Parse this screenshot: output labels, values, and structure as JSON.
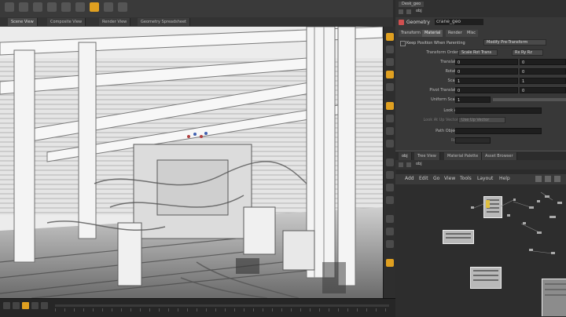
{
  "colors": {
    "accent": "#e0a020",
    "viewport_bg": "#e8e8e8",
    "panel_bg": "#383838",
    "node": "#b9b9b9"
  },
  "viewport_tabs": [
    "Scene View",
    "Composite View",
    "Render View",
    "Geometry Spreadsheet"
  ],
  "right_top": {
    "tab": "Desk_geo",
    "path": "obj"
  },
  "param": {
    "node_type": "Geometry",
    "node_name": "crane_geo",
    "tabs": [
      "Transform",
      "Material",
      "Render",
      "Misc"
    ],
    "keep_position_label": "Keep Position When Parenting",
    "keep_position_value": "Modify Pre-Transform",
    "rows": [
      {
        "label": "Transform Order",
        "v1": "Scale Rot Trans",
        "v2": "Rx Ry Rz"
      },
      {
        "label": "Translate",
        "x": "0",
        "y": "0"
      },
      {
        "label": "Rotate",
        "x": "0",
        "y": "0"
      },
      {
        "label": "Scale",
        "x": "1",
        "y": "1"
      },
      {
        "label": "Pivot Translate",
        "x": "0",
        "y": "0"
      },
      {
        "label": "Uniform Scale",
        "x": "1"
      },
      {
        "label": "Look At",
        "x": ""
      },
      {
        "label": "Look At Up Vector",
        "x": "Use Up Vector"
      },
      {
        "label": "Path Object",
        "x": ""
      },
      {
        "label": "Roll",
        "x": ""
      }
    ]
  },
  "network": {
    "tabs": [
      "Tree View",
      "Material Palette",
      "Asset Browser"
    ],
    "path": "obj",
    "menu": [
      "Add",
      "Edit",
      "Go",
      "View",
      "Tools",
      "Layout",
      "Help"
    ]
  }
}
